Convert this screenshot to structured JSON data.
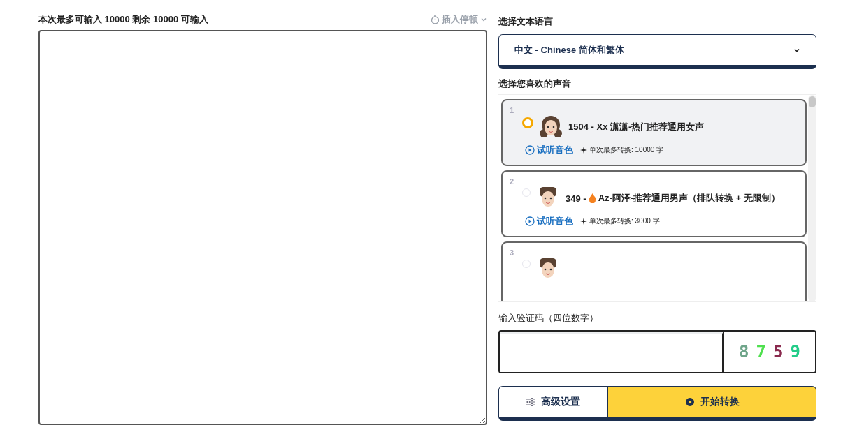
{
  "editor": {
    "counter": "本次最多可输入 10000 剩余 10000 可输入",
    "pause_button": "插入停顿"
  },
  "language": {
    "label": "选择文本语言",
    "value": "中文 - Chinese 简体和繁体"
  },
  "voices": {
    "label": "选择您喜欢的声音",
    "items": [
      {
        "index": "1",
        "selected": true,
        "kind": "female",
        "prefix": "1504 - ",
        "hot": false,
        "name": "Xx 潇潇-热门推荐通用女声",
        "preview": "试听音色",
        "limit": "单次最多转换: 10000 字"
      },
      {
        "index": "2",
        "selected": false,
        "kind": "male",
        "prefix": "349 - ",
        "hot": true,
        "name": "Az-阿泽-推荐通用男声（排队转换 + 无限制）",
        "preview": "试听音色",
        "limit": "单次最多转换: 3000 字"
      },
      {
        "index": "3",
        "selected": false,
        "kind": "male"
      }
    ]
  },
  "captcha": {
    "label": "输入验证码（四位数字）",
    "chars": [
      {
        "char": "8",
        "color": "#6fa58a"
      },
      {
        "char": "7",
        "color": "#4ee04e"
      },
      {
        "char": "5",
        "color": "#8a2a4e"
      },
      {
        "char": "9",
        "color": "#22cc88"
      }
    ]
  },
  "buttons": {
    "settings": "高级设置",
    "start": "开始转换"
  }
}
